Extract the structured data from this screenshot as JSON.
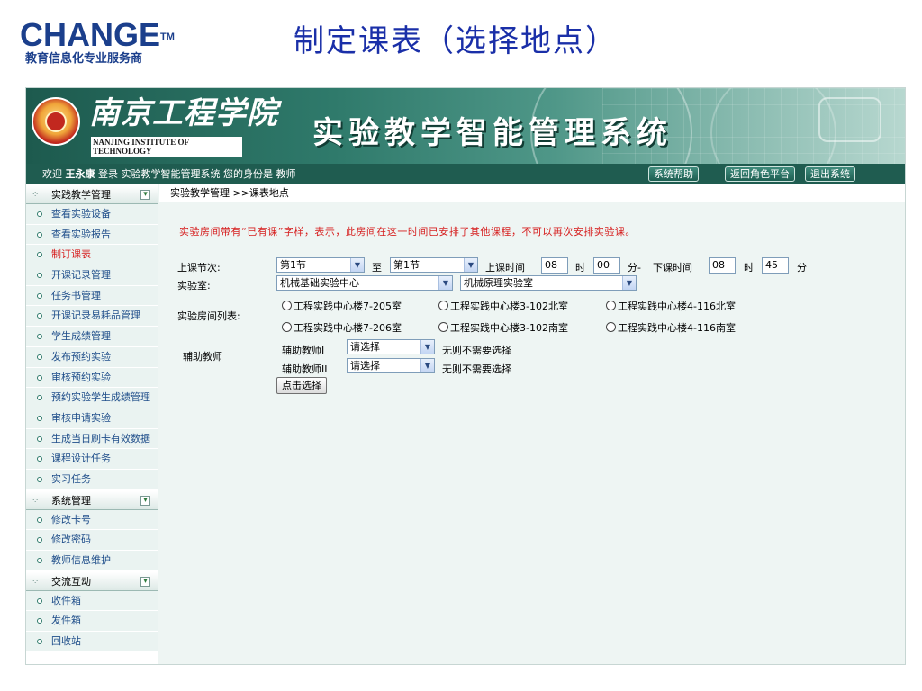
{
  "slide": {
    "brand_logo": "CHANGE",
    "brand_tm": "TM",
    "brand_tagline": "教育信息化专业服务商",
    "title": "制定课表（选择地点）"
  },
  "banner": {
    "school_cn": "南京工程学院",
    "school_en": "NANJING INSTITUTE OF TECHNOLOGY",
    "system_name": "实验教学智能管理系统"
  },
  "infobar": {
    "welcome_prefix": "欢迎",
    "user_name": "王永康",
    "login_text": "登录 实验教学智能管理系统",
    "role_text": "您的身份是 教师",
    "buttons": [
      "系统帮助",
      "返回角色平台",
      "退出系统"
    ]
  },
  "sidebar": {
    "sections": [
      {
        "title": "实践教学管理",
        "items": [
          "查看实验设备",
          "查看实验报告",
          "制订课表",
          "开课记录管理",
          "任务书管理",
          "开课记录易耗品管理",
          "学生成绩管理",
          "发布预约实验",
          "审核预约实验",
          "预约实验学生成绩管理",
          "审核申请实验",
          "生成当日刷卡有效数据",
          "课程设计任务",
          "实习任务"
        ]
      },
      {
        "title": "系统管理",
        "items": [
          "修改卡号",
          "修改密码",
          "教师信息维护"
        ]
      },
      {
        "title": "交流互动",
        "items": [
          "收件箱",
          "发件箱",
          "回收站"
        ]
      }
    ],
    "active_item": "制订课表"
  },
  "content": {
    "breadcrumb": "实验教学管理 >>课表地点",
    "notice": "实验房间带有“已有课”字样，表示，此房间在这一时间已安排了其他课程，不可以再次安排实验课。",
    "form": {
      "period_label": "上课节次:",
      "period_from": "第1节",
      "period_to_label": "至",
      "period_to": "第1节",
      "start_label": "上课时间",
      "start_hour": "08",
      "hour_unit": "时",
      "start_min": "00",
      "min_unit_dash": "分-",
      "end_label": "下课时间",
      "end_hour": "08",
      "end_min": "45",
      "min_unit": "分",
      "lab_label": "实验室:",
      "lab_center": "机械基础实验中心",
      "lab_room": "机械原理实验室",
      "room_list_label": "实验房间列表:",
      "rooms": [
        "工程实践中心楼7-205室",
        "工程实践中心楼3-102北室",
        "工程实践中心楼4-116北室",
        "工程实践中心楼7-206室",
        "工程实践中心楼3-102南室",
        "工程实践中心楼4-116南室"
      ],
      "assistant_label": "辅助教师",
      "assistant1_label": "辅助教师I",
      "assistant2_label": "辅助教师II",
      "assistant_select": "请选择",
      "assistant_hint": "无则不需要选择",
      "submit": "点击选择"
    }
  }
}
